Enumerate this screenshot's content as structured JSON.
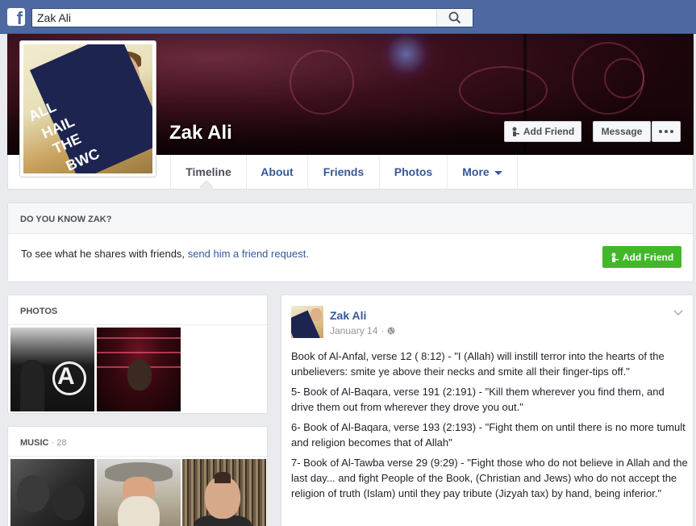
{
  "header": {
    "logo_letter": "f",
    "logo_icon": "facebook-logo-icon",
    "search_value": "Zak Ali",
    "search_icon": "search-icon"
  },
  "profile": {
    "name": "Zak Ali",
    "picture_text": [
      "ALL",
      "HAIL",
      "THE",
      "BWC"
    ],
    "actions": {
      "add_friend": "Add Friend",
      "message": "Message"
    }
  },
  "nav": {
    "tabs": [
      {
        "label": "Timeline",
        "active": true
      },
      {
        "label": "About"
      },
      {
        "label": "Friends"
      },
      {
        "label": "Photos"
      },
      {
        "label": "More"
      }
    ]
  },
  "know": {
    "title": "DO YOU KNOW ZAK?",
    "text": "To see what he shares with friends,",
    "link": "send him a friend request.",
    "button": "Add Friend"
  },
  "photos": {
    "title": "PHOTOS"
  },
  "music": {
    "title": "MUSIC",
    "count": "· 28"
  },
  "post": {
    "author": "Zak Ali",
    "date": "January 14",
    "separator": "·",
    "privacy_icon": "globe-icon",
    "paragraphs": [
      "Book of Al-Anfal, verse 12 ( 8:12) - \"I (Allah) will instill terror into the hearts of the unbelievers: smite ye above their necks and smite all their finger-tips off.\"",
      "5- Book of Al-Baqara, verse 191 (2:191) - \"Kill them wherever you find them, and drive them out from wherever they drove you out.\"",
      "6- Book of Al-Baqara, verse 193 (2:193) - \"Fight them on until there is no more tumult and religion becomes that of Allah\"",
      "7- Book of Al-Tawba verse 29 (9:29) - \"Fight those who do not believe in Allah and the last day... and fight People of the Book, (Christian and Jews) who do not accept the religion of truth (Islam) until they pay tribute (Jizyah tax) by hand, being inferior.\""
    ]
  },
  "colors": {
    "brand_blue": "#4e69a2",
    "link_blue": "#365899",
    "green": "#42b72a",
    "background": "#e9ebee"
  }
}
